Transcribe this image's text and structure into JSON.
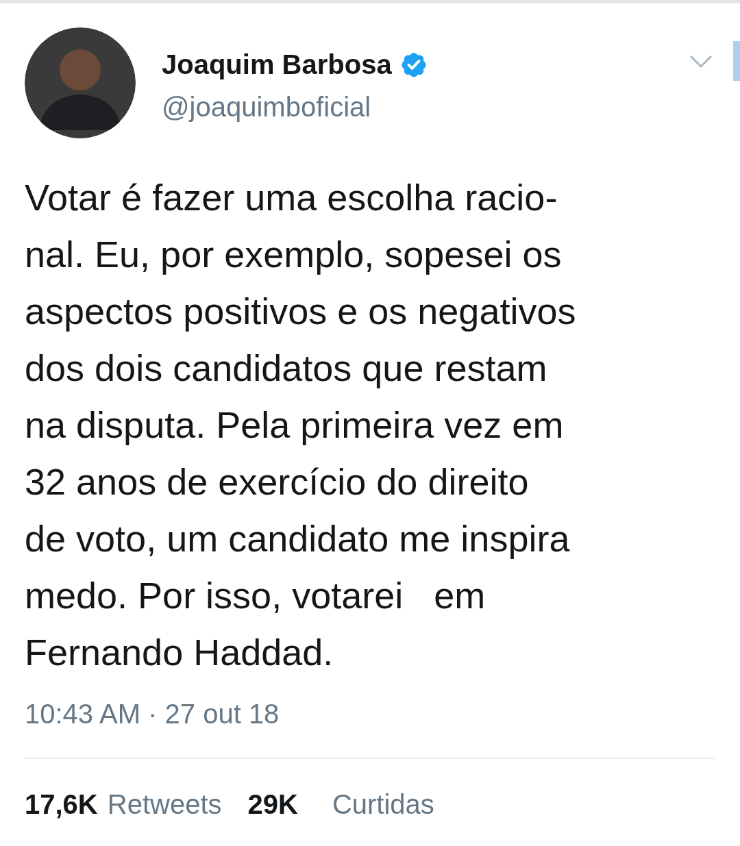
{
  "author": {
    "name": "Joaquim Barbosa",
    "verified": true,
    "handle": "@joaquimboficial"
  },
  "tweet": {
    "text": "Votar é fazer uma escolha racio-\nnal. Eu, por exemplo, sopesei os\naspectos positivos e os negativos\ndos dois candidatos que restam\nna disputa. Pela primeira vez em\n32 anos de exercício do direito\nde voto, um candidato me inspira\nmedo. Por isso, votarei   em\nFernando Haddad.",
    "timestamp": "10:43 AM · 27 out 18"
  },
  "stats": [
    {
      "count": "17,6K",
      "label": "Retweets"
    },
    {
      "count": "29K",
      "label": "Curtidas"
    }
  ]
}
